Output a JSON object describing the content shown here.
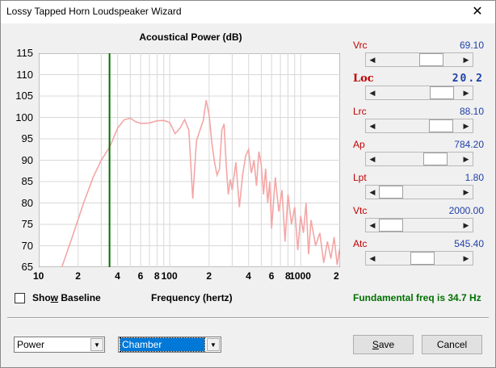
{
  "window": {
    "title": "Lossy Tapped Horn Loudspeaker Wizard",
    "close_glyph": "✕"
  },
  "chart": {
    "title": "Acoustical Power (dB)",
    "xlabel": "Frequency (hertz)"
  },
  "chart_data": {
    "type": "line",
    "title": "Acoustical Power (dB)",
    "xlabel": "Frequency (hertz)",
    "ylabel": "",
    "xscale": "log",
    "xlim": [
      10,
      2000
    ],
    "ylim": [
      65,
      115
    ],
    "yticks": [
      "115",
      "110",
      "105",
      "100",
      "95",
      "90",
      "85",
      "80",
      "75",
      "70",
      "65"
    ],
    "xticks": [
      "10",
      "2",
      "4",
      "6",
      "8",
      "100",
      "2",
      "4",
      "6",
      "8",
      "1000",
      "2"
    ],
    "xtick_freqs": [
      10,
      20,
      40,
      60,
      80,
      100,
      200,
      400,
      600,
      800,
      1000,
      2000
    ],
    "marker_freq": 34.7,
    "marker_color": "#007000",
    "line_color": "#f4a6a6",
    "grid": true,
    "series": [
      {
        "x": [
          15,
          18,
          22,
          26,
          30,
          34.7,
          40,
          45,
          50,
          55,
          60,
          70,
          80,
          90,
          100,
          110,
          120,
          130,
          140,
          150,
          160,
          170,
          180,
          190,
          200,
          210,
          220,
          230,
          240,
          250,
          260,
          270,
          280,
          290,
          300,
          320,
          340,
          360,
          380,
          400,
          420,
          440,
          460,
          480,
          500,
          520,
          540,
          560,
          580,
          600,
          640,
          680,
          720,
          760,
          800,
          850,
          900,
          950,
          1000,
          1050,
          1100,
          1150,
          1200,
          1300,
          1400,
          1500,
          1600,
          1700,
          1800,
          1900,
          2000
        ],
        "y": [
          65,
          72,
          80,
          86,
          90,
          93,
          97.5,
          99.5,
          99.8,
          99,
          98.6,
          98.7,
          99.2,
          99.3,
          98.8,
          96.2,
          97.5,
          99.5,
          97,
          81,
          94.5,
          97,
          99.2,
          104,
          100.5,
          94,
          89.5,
          86.5,
          88,
          97,
          98.5,
          89,
          82,
          85.5,
          83,
          89.5,
          79,
          86.5,
          91,
          92.5,
          87,
          90,
          84,
          92,
          89,
          82,
          88,
          80,
          85,
          74,
          86,
          78,
          83,
          71,
          82,
          75,
          79,
          69,
          77,
          73,
          80,
          68,
          76,
          70,
          73,
          66,
          71,
          67,
          72,
          65.5,
          70
        ]
      }
    ]
  },
  "controls": [
    {
      "name": "Vrc",
      "value": "69.10",
      "fraction": 0.72
    },
    {
      "name": "Loc",
      "value": "20.2",
      "fraction": 0.9,
      "big": true
    },
    {
      "name": "Lrc",
      "value": "88.10",
      "fraction": 0.88
    },
    {
      "name": "Ap",
      "value": "784.20",
      "fraction": 0.78
    },
    {
      "name": "Lpt",
      "value": "1.80",
      "fraction": 0.0
    },
    {
      "name": "Vtc",
      "value": "2000.00",
      "fraction": 0.0
    },
    {
      "name": "Atc",
      "value": "545.40",
      "fraction": 0.55
    }
  ],
  "fundamental": "Fundamental freq is 34.7 Hz",
  "show_baseline": {
    "label_pre": "Sho",
    "label_key": "w",
    "label_post": " Baseline",
    "checked": false
  },
  "combo_power": {
    "value": "Power"
  },
  "combo_chamber": {
    "value": "Chamber"
  },
  "buttons": {
    "save_pre": "",
    "save_key": "S",
    "save_post": "ave",
    "cancel": "Cancel"
  },
  "arrows": {
    "left": "◀",
    "right": "▶",
    "down": "▼"
  }
}
